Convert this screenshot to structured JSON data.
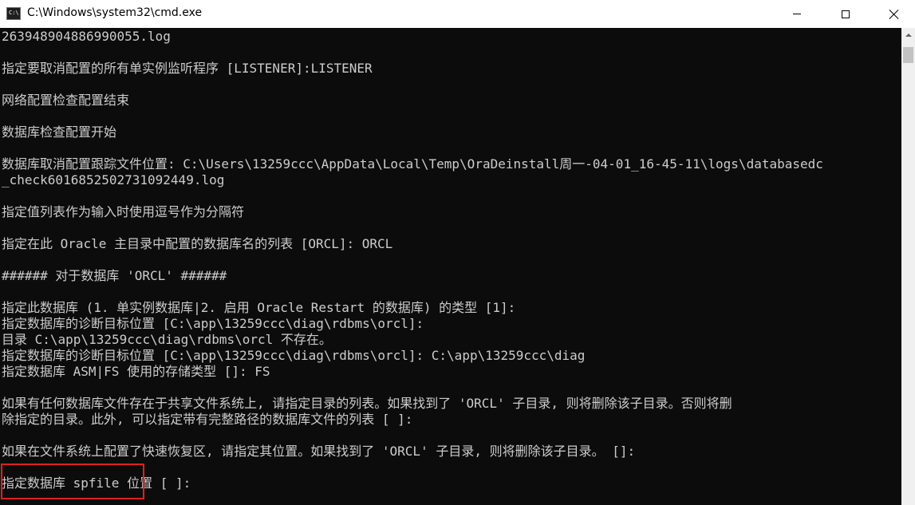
{
  "window": {
    "title": "C:\\Windows\\system32\\cmd.exe",
    "icon_text": "C:\\"
  },
  "console": {
    "lines": [
      "263948904886990055.log",
      "",
      "指定要取消配置的所有单实例监听程序 [LISTENER]:LISTENER",
      "",
      "网络配置检查配置结束",
      "",
      "数据库检查配置开始",
      "",
      "数据库取消配置跟踪文件位置: C:\\Users\\13259ccc\\AppData\\Local\\Temp\\OraDeinstall周一-04-01_16-45-11\\logs\\databasedc",
      "_check6016852502731092449.log",
      "",
      "指定值列表作为输入时使用逗号作为分隔符",
      "",
      "指定在此 Oracle 主目录中配置的数据库名的列表 [ORCL]: ORCL",
      "",
      "###### 对于数据库 'ORCL' ######",
      "",
      "指定此数据库 (1. 单实例数据库|2. 启用 Oracle Restart 的数据库) 的类型 [1]:",
      "指定数据库的诊断目标位置 [C:\\app\\13259ccc\\diag\\rdbms\\orcl]:",
      "目录 C:\\app\\13259ccc\\diag\\rdbms\\orcl 不存在。",
      "指定数据库的诊断目标位置 [C:\\app\\13259ccc\\diag\\rdbms\\orcl]: C:\\app\\13259ccc\\diag",
      "指定数据库 ASM|FS 使用的存储类型 []: FS",
      "",
      "如果有任何数据库文件存在于共享文件系统上, 请指定目录的列表。如果找到了 'ORCL' 子目录, 则将删除该子目录。否则将删",
      "除指定的目录。此外, 可以指定带有完整路径的数据库文件的列表 [ ]:",
      "",
      "如果在文件系统上配置了快速恢复区, 请指定其位置。如果找到了 'ORCL' 子目录, 则将删除该子目录。 []:",
      "",
      "指定数据库 spfile 位置 [ ]:"
    ]
  },
  "highlight": {
    "color": "#e02020"
  }
}
